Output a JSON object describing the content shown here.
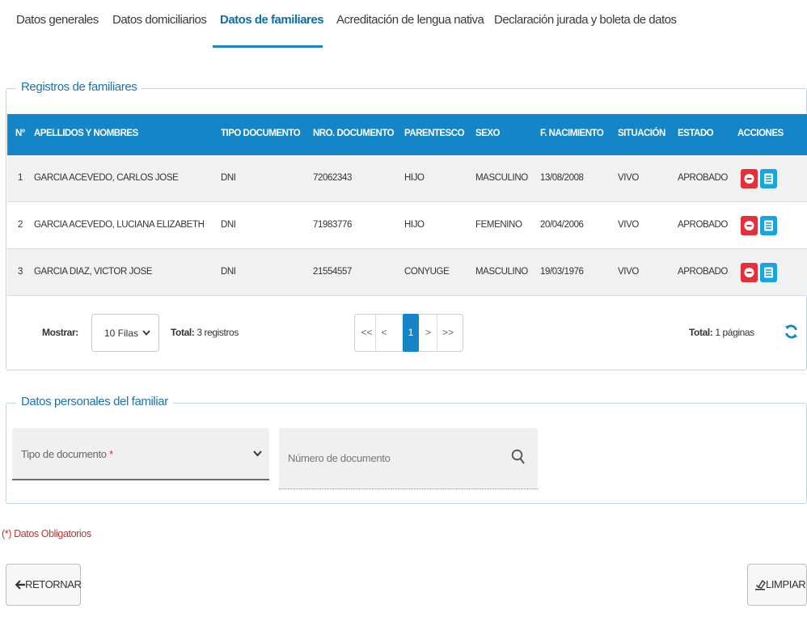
{
  "tabs": [
    {
      "label": "Datos generales",
      "active": false
    },
    {
      "label": "Datos domiciliarios",
      "active": false
    },
    {
      "label": "Datos de familiares",
      "active": true
    },
    {
      "label": "Acreditación de lengua nativa",
      "active": false
    },
    {
      "label": "Declaración jurada y boleta de datos",
      "active": false
    }
  ],
  "registros": {
    "legend": "Registros de familiares",
    "columns": [
      "N°",
      "APELLIDOS Y NOMBRES",
      "TIPO DOCUMENTO",
      "NRO. DOCUMENTO",
      "PARENTESCO",
      "SEXO",
      "F. NACIMIENTO",
      "SITUACIÓN",
      "ESTADO",
      "ACCIONES"
    ],
    "rows": [
      {
        "n": "1",
        "nombre": "GARCIA ACEVEDO, CARLOS JOSE",
        "tipo": "DNI",
        "nro": "72062343",
        "parentesco": "HIJO",
        "sexo": "MASCULINO",
        "fnac": "13/08/2008",
        "situacion": "VIVO",
        "estado": "APROBADO"
      },
      {
        "n": "2",
        "nombre": "GARCIA ACEVEDO, LUCIANA ELIZABETH",
        "tipo": "DNI",
        "nro": "71983776",
        "parentesco": "HIJO",
        "sexo": "FEMENINO",
        "fnac": "20/04/2006",
        "situacion": "VIVO",
        "estado": "APROBADO"
      },
      {
        "n": "3",
        "nombre": "GARCIA DIAZ, VICTOR JOSE",
        "tipo": "DNI",
        "nro": "21554557",
        "parentesco": "CONYUGE",
        "sexo": "MASCULINO",
        "fnac": "19/03/1976",
        "situacion": "VIVO",
        "estado": "APROBADO"
      }
    ]
  },
  "pagination": {
    "mostrar_label": "Mostrar:",
    "filas_value": "10 Filas",
    "total_label": "Total:",
    "total_registros": "3 registros",
    "first": "<<",
    "prev": "<",
    "current_page": "1",
    "next": ">",
    "last": ">>",
    "total_paginas_label": "Total:",
    "total_paginas": "1 páginas"
  },
  "familiar": {
    "legend": "Datos personales del familiar",
    "tipo_placeholder": "Tipo de documento",
    "required_mark": "*",
    "numero_placeholder": "Número de documento"
  },
  "required_note": "(*) Datos Obligatorios",
  "buttons": {
    "retornar": "RETORNAR",
    "limpiar": "LIMPIAR"
  },
  "colors": {
    "primary": "#1486c7",
    "danger": "#e4303b",
    "info": "#18a4dd"
  }
}
